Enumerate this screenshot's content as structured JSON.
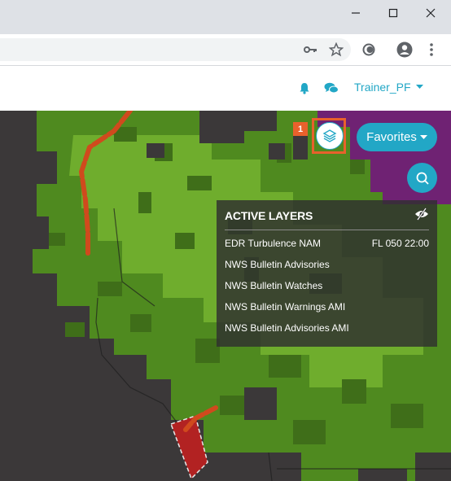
{
  "browser": {
    "window_controls": {
      "minimize": "—",
      "maximize": "☐",
      "close": "✕"
    },
    "toolbar_icons": [
      "key-icon",
      "star-icon",
      "extension-icon",
      "account-icon",
      "menu-dots-icon"
    ]
  },
  "header": {
    "icons": [
      "bell-icon",
      "chat-icon"
    ],
    "user_name": "Trainer_PF",
    "accent_color": "#22a7c6"
  },
  "map_controls": {
    "layers_badge": "1",
    "favorites_label": "Favorites",
    "highlight_color": "#e8612c"
  },
  "active_layers": {
    "title": "ACTIVE LAYERS",
    "items": [
      {
        "name": "EDR Turbulence NAM",
        "detail": "FL 050 22:00"
      },
      {
        "name": "NWS Bulletin Advisories",
        "detail": ""
      },
      {
        "name": "NWS Bulletin Watches",
        "detail": ""
      },
      {
        "name": "NWS Bulletin Warnings AMI",
        "detail": ""
      },
      {
        "name": "NWS Bulletin Advisories AMI",
        "detail": ""
      }
    ]
  }
}
